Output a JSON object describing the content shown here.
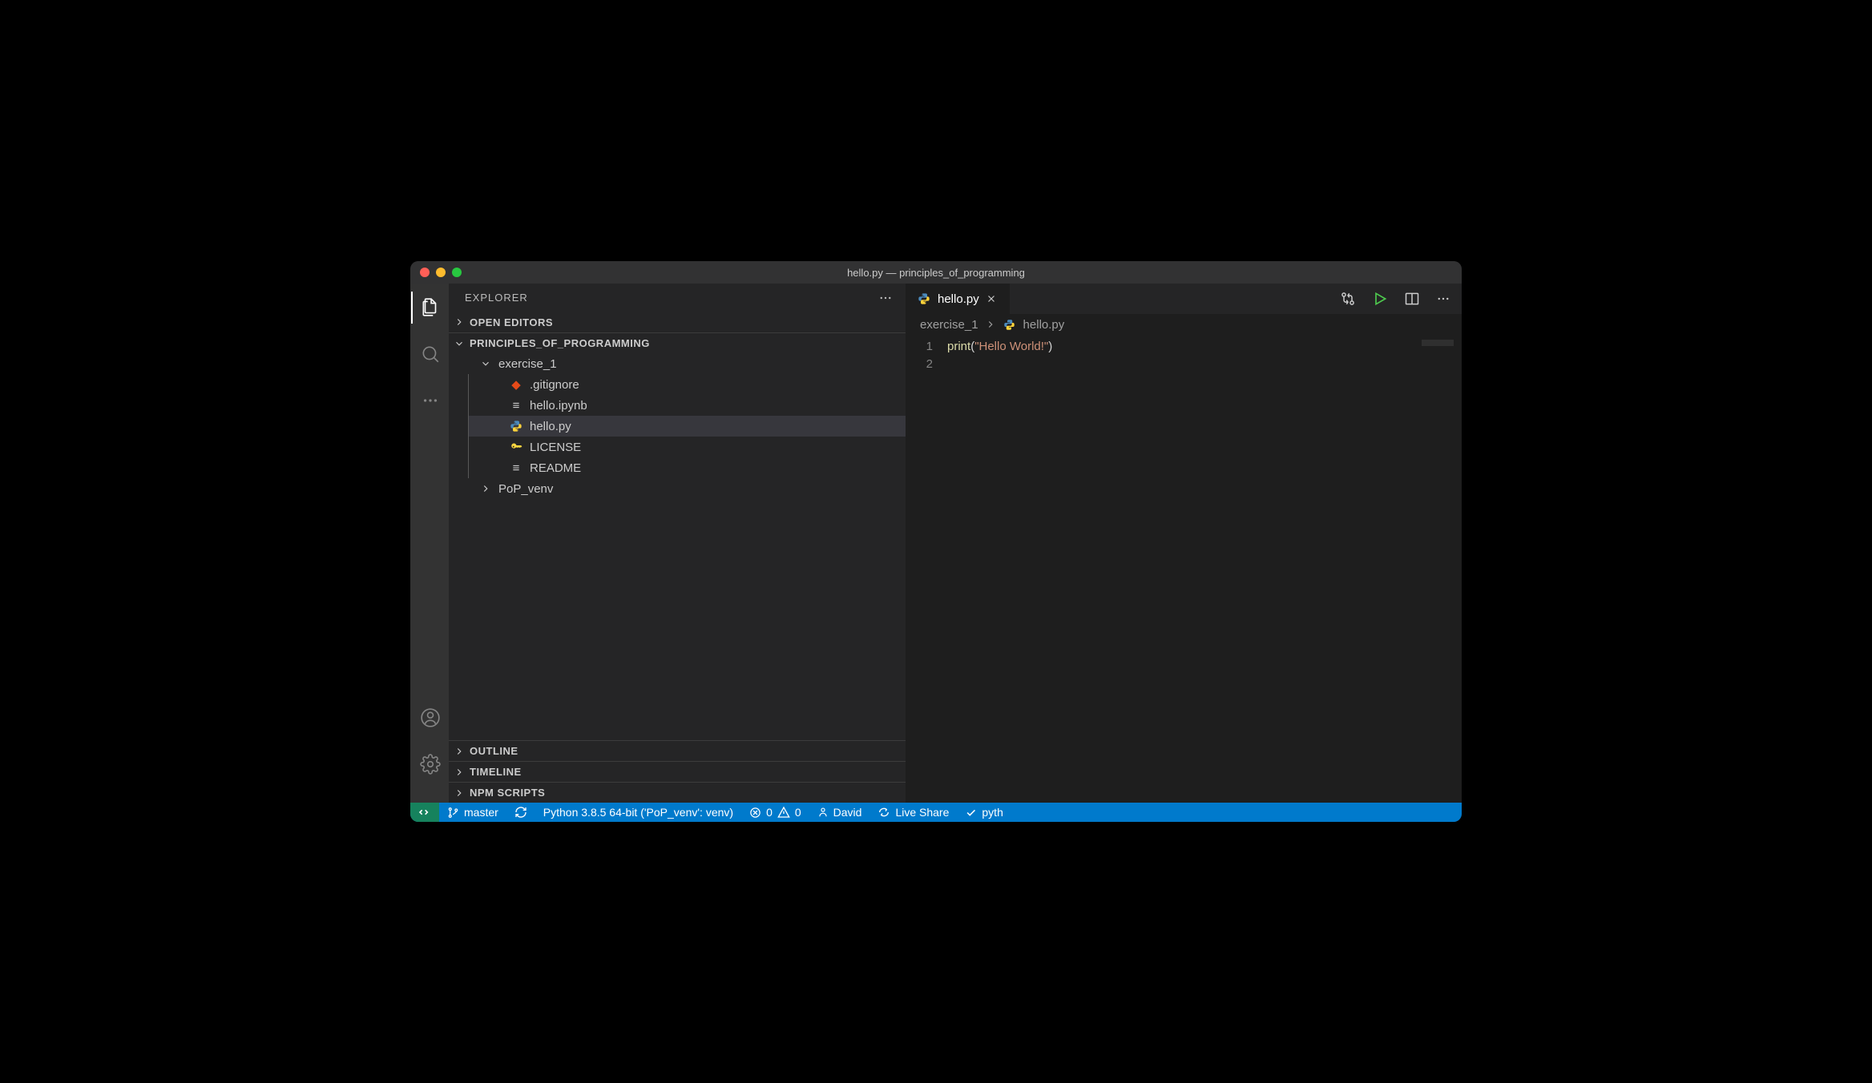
{
  "window": {
    "title": "hello.py — principles_of_programming"
  },
  "sidebar": {
    "title": "EXPLORER",
    "sections": {
      "open_editors": "OPEN EDITORS",
      "workspace": "PRINCIPLES_OF_PROGRAMMING",
      "outline": "OUTLINE",
      "timeline": "TIMELINE",
      "npm": "NPM SCRIPTS"
    },
    "tree": {
      "folder": "exercise_1",
      "files": [
        {
          "name": ".gitignore",
          "icon": "git"
        },
        {
          "name": "hello.ipynb",
          "icon": "text"
        },
        {
          "name": "hello.py",
          "icon": "python",
          "selected": true
        },
        {
          "name": "LICENSE",
          "icon": "key"
        },
        {
          "name": "README",
          "icon": "text"
        }
      ],
      "folder2": "PoP_venv"
    }
  },
  "editor": {
    "tab": {
      "label": "hello.py"
    },
    "breadcrumb": {
      "folder": "exercise_1",
      "file": "hello.py"
    },
    "code": {
      "line1_fn": "print",
      "line1_open": "(",
      "line1_str": "\"Hello World!\"",
      "line1_close": ")",
      "lineno1": "1",
      "lineno2": "2"
    }
  },
  "statusbar": {
    "branch": "master",
    "interpreter": "Python 3.8.5 64-bit ('PoP_venv': venv)",
    "errors": "0",
    "warnings": "0",
    "user": "David",
    "liveshare": "Live Share",
    "lang": "pyth"
  }
}
